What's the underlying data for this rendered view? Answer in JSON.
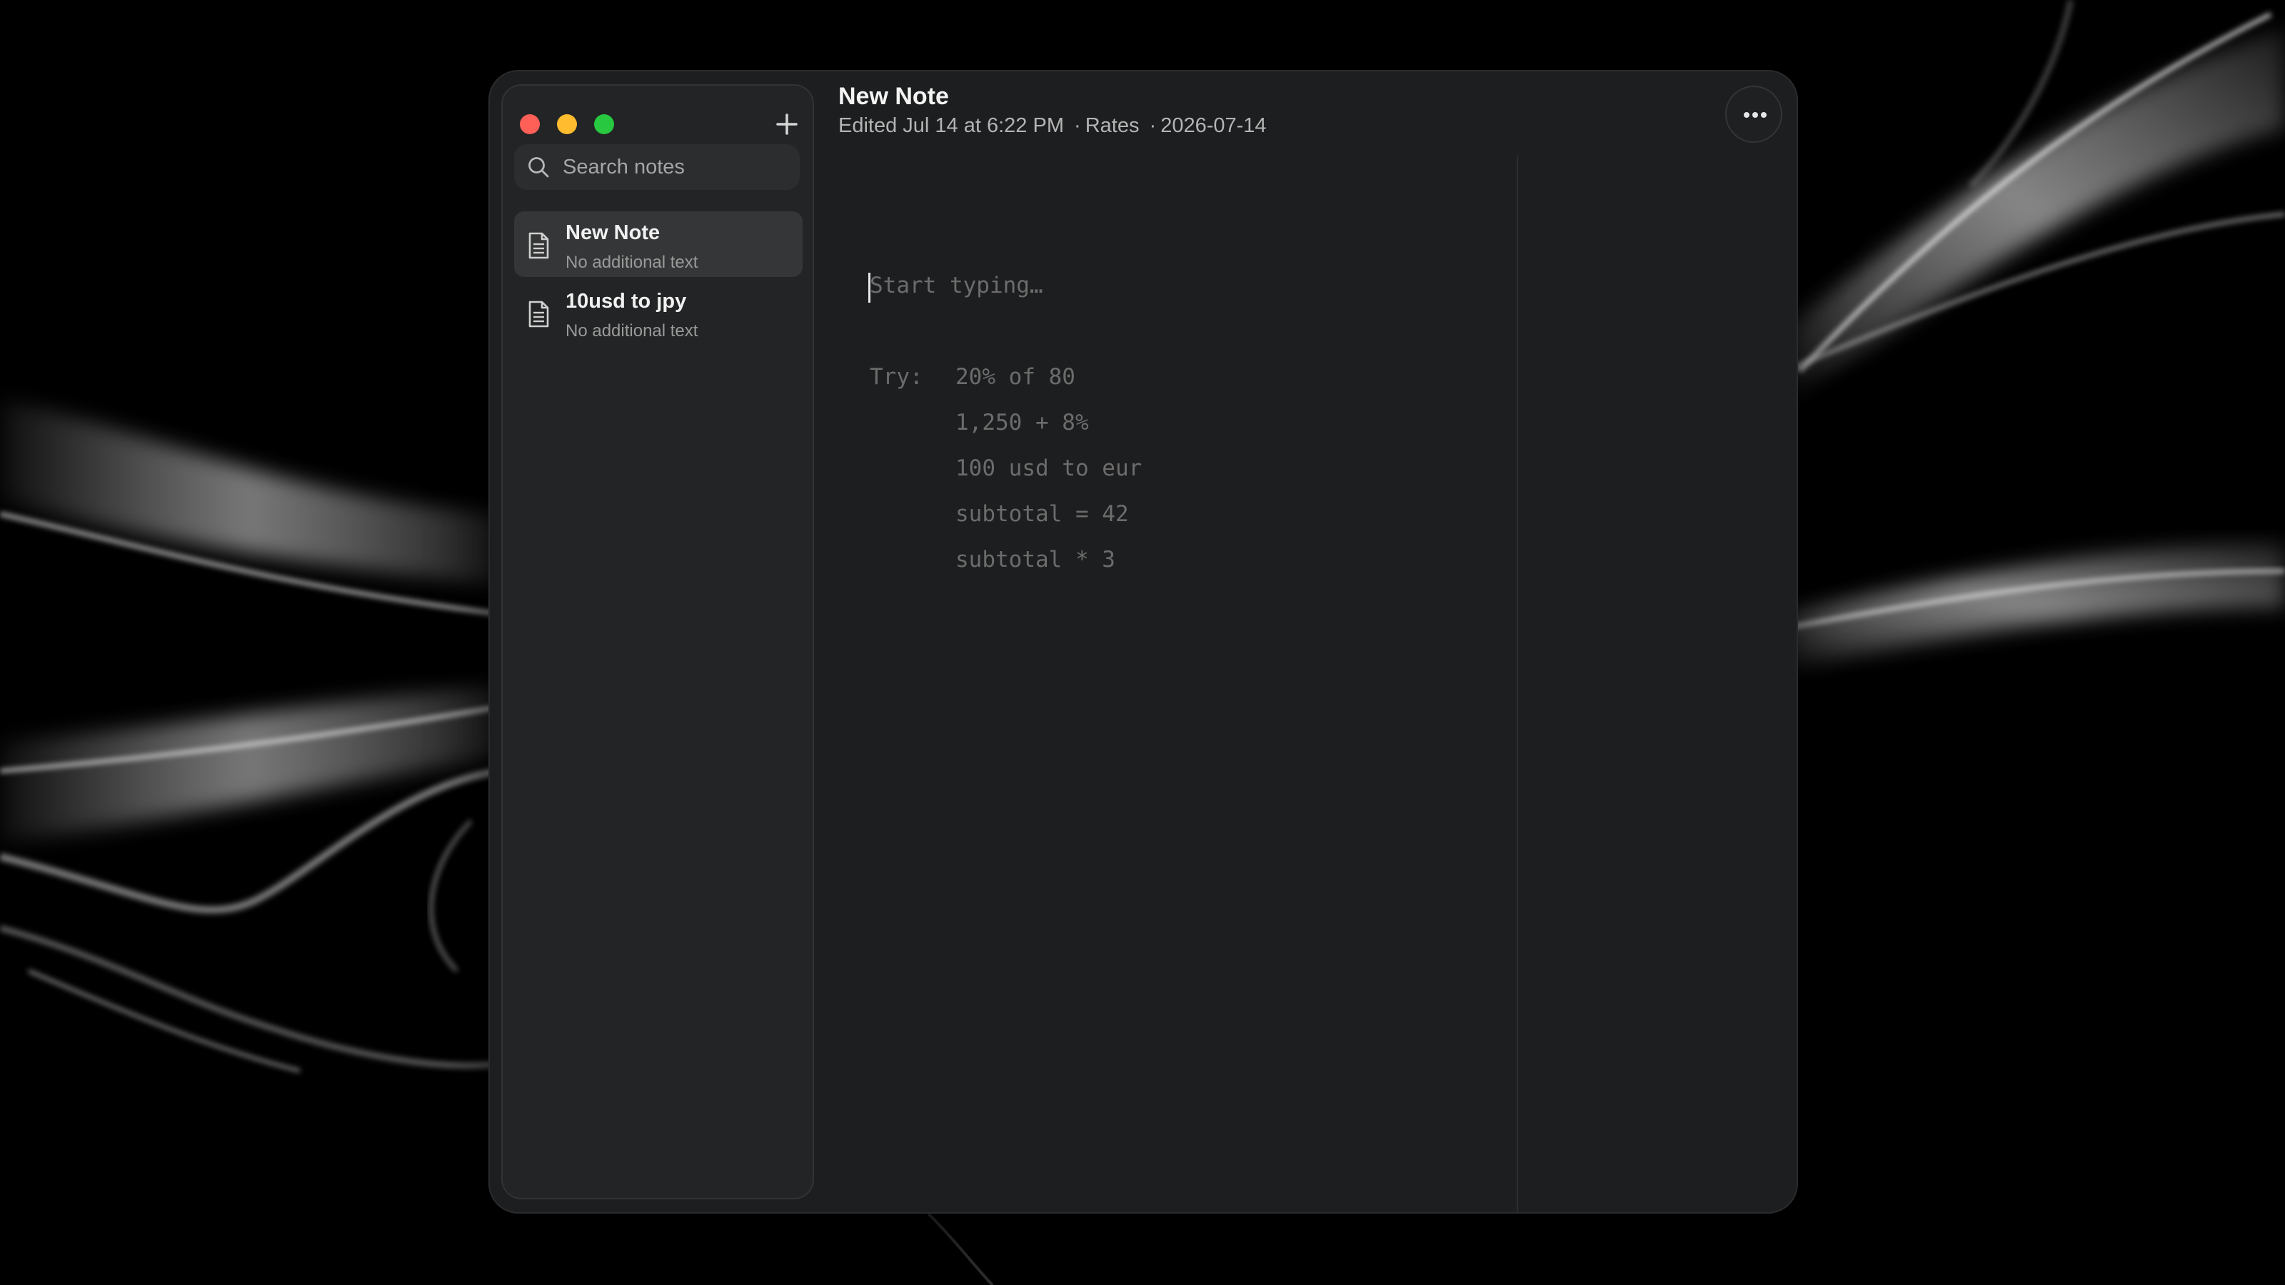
{
  "window": {
    "traffic_lights": {
      "close_color": "#fe5f57",
      "minimize_color": "#febc2e",
      "maximize_color": "#28c840"
    }
  },
  "sidebar": {
    "new_note_icon": "plus-icon",
    "search": {
      "placeholder": "Search notes",
      "value": "",
      "icon": "search-icon"
    },
    "notes": [
      {
        "title": "New Note",
        "subtitle": "No additional text",
        "icon": "document-icon",
        "selected": true
      },
      {
        "title": "10usd to jpy",
        "subtitle": "No additional text",
        "icon": "document-icon",
        "selected": false
      }
    ]
  },
  "header": {
    "title": "New Note",
    "edited": "Edited Jul 14 at 6:22 PM",
    "separator": "·",
    "rates_label": "Rates",
    "rates_date": "2026-07-14",
    "more_icon": "ellipsis-icon"
  },
  "editor": {
    "placeholder": "Start typing…",
    "try_label": "Try:",
    "examples": [
      "20% of 80",
      "1,250 + 8%",
      "100 usd to eur",
      "subtotal = 42",
      "subtotal * 3"
    ]
  }
}
